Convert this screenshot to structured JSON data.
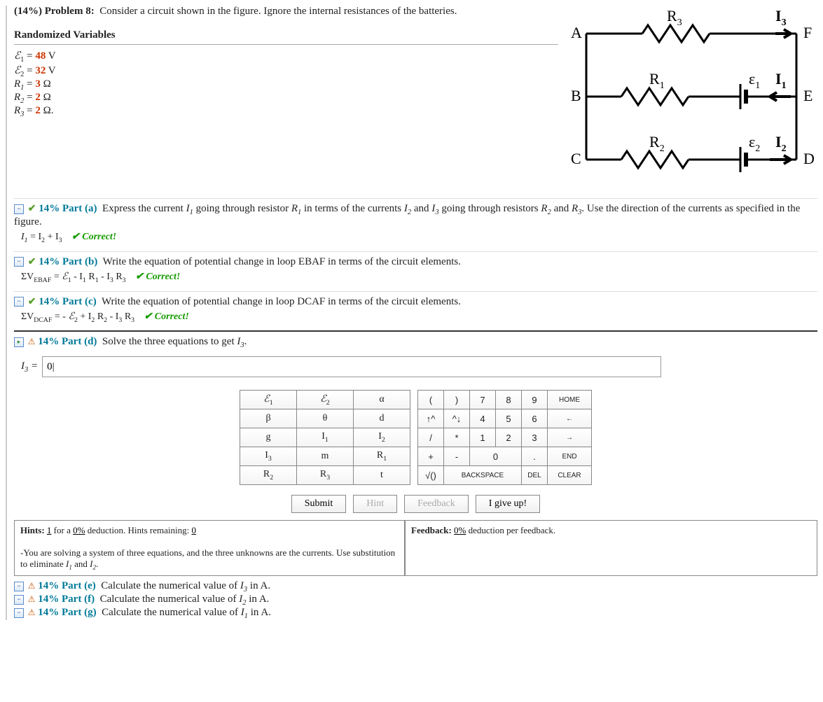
{
  "problem": {
    "percent": "(14%)",
    "label": "Problem 8:",
    "text": "Consider a circuit shown in the figure. Ignore the internal resistances of the batteries."
  },
  "variables_heading": "Randomized Variables",
  "vars": {
    "e1_val": "48",
    "e1_unit": "V",
    "e2_val": "32",
    "e2_unit": "V",
    "r1_val": "3",
    "r1_unit": "Ω",
    "r2_val": "2",
    "r2_unit": "Ω",
    "r3_val": "2",
    "r3_unit": "Ω."
  },
  "circuit_labels": {
    "A": "A",
    "B": "B",
    "C": "C",
    "D": "D",
    "E": "E",
    "F": "F",
    "R1": "R",
    "R2": "R",
    "R3": "R",
    "e1": "ε",
    "e2": "ε",
    "I1": "I",
    "I2": "I",
    "I3": "I"
  },
  "parts": {
    "a": {
      "label": "14% Part (a)",
      "text": "Express the current I₁ going through resistor R₁ in terms of the currents I₂ and I₃ going through resistors R₂ and R₃. Use the direction of the currents as specified in the figure.",
      "answer_prefix": "I₁ = I₂ + I₃",
      "status": "Correct!"
    },
    "b": {
      "label": "14% Part (b)",
      "text": "Write the equation of potential change in loop EBAF in terms of the circuit elements.",
      "answer_prefix": "ΣV",
      "answer_sub": "EBAF",
      "answer_rest": " = ℰ₁ - I₁ R₁ - I₃ R₃",
      "status": "Correct!"
    },
    "c": {
      "label": "14% Part (c)",
      "text": "Write the equation of potential change in loop DCAF in terms of the circuit elements.",
      "answer_prefix": "ΣV",
      "answer_sub": "DCAF",
      "answer_rest": " = - ℰ₂ + I₂ R₂ - I₃ R₃",
      "status": "Correct!"
    },
    "d": {
      "label": "14% Part (d)",
      "text": "Solve the three equations to get I₃.",
      "input_label": "I₃ = ",
      "input_value": "0|"
    },
    "e": {
      "label": "14% Part (e)",
      "text": "Calculate the numerical value of I₃ in A."
    },
    "f": {
      "label": "14% Part (f)",
      "text": "Calculate the numerical value of I₂ in A."
    },
    "g": {
      "label": "14% Part (g)",
      "text": "Calculate the numerical value of I₁ in A."
    }
  },
  "keypad_symbols": [
    [
      "ℰ₁",
      "ℰ₂",
      "α"
    ],
    [
      "β",
      "θ",
      "d"
    ],
    [
      "g",
      "I₁",
      "I₂"
    ],
    [
      "I₃",
      "m",
      "R₁"
    ],
    [
      "R₂",
      "R₃",
      "t"
    ]
  ],
  "keypad_num": [
    [
      [
        "(",
        " ",
        ")",
        "7",
        "8",
        "9"
      ],
      [
        "HOME"
      ]
    ],
    [
      [
        "↑^",
        " ",
        "^↓",
        "4",
        "5",
        "6"
      ],
      [
        "←"
      ]
    ],
    [
      [
        "/",
        " ",
        "*",
        "1",
        "2",
        "3"
      ],
      [
        "→"
      ]
    ],
    [
      [
        "+",
        " ",
        "-",
        "0",
        " ",
        "."
      ],
      [
        "END"
      ]
    ],
    [
      [
        "√()",
        "BACKSPACE",
        "DEL"
      ],
      [
        "CLEAR"
      ]
    ]
  ],
  "numrows": {
    "r1": {
      "c": [
        "(",
        ")",
        "7",
        "8",
        "9"
      ],
      "extra": "HOME"
    },
    "r2": {
      "c": [
        "↑^",
        "^↓",
        "4",
        "5",
        "6"
      ],
      "extra": "←"
    },
    "r3": {
      "c": [
        "/",
        "*",
        "1",
        "2",
        "3"
      ],
      "extra": "→"
    },
    "r4": {
      "c": [
        "+",
        "-",
        "0",
        "",
        "."
      ],
      "extra": "END",
      "zero_wide": true
    },
    "r5": {
      "sqrt": "√()",
      "bksp": "BACKSPACE",
      "del": "DEL",
      "extra": "CLEAR"
    }
  },
  "buttons": {
    "submit": "Submit",
    "hint": "Hint",
    "feedback": "Feedback",
    "giveup": "I give up!"
  },
  "hints": {
    "label": "Hints:",
    "count": "1",
    "mid": " for a ",
    "pct": "0%",
    "mid2": " deduction. Hints remaining: ",
    "remain": "0",
    "text": "-You are solving a system of three equations, and the three unknowns are the currents. Use substitution to eliminate I₁ and I₂."
  },
  "feedback": {
    "label": "Feedback: ",
    "pct": "0%",
    "rest": " deduction per feedback."
  }
}
